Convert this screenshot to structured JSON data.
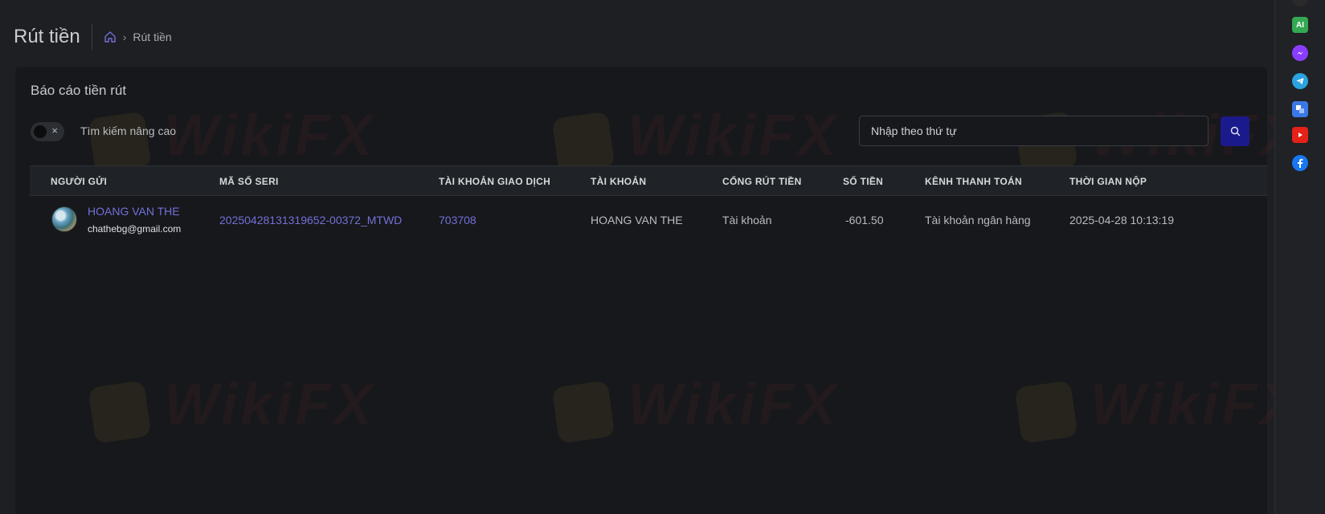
{
  "header": {
    "title": "Rút tiền",
    "breadcrumb_current": "Rút tiền"
  },
  "card": {
    "title": "Báo cáo tiền rút",
    "advanced_search_label": "Tìm kiếm nâng cao",
    "toggle_x": "×",
    "search_placeholder": "Nhập theo thứ tự"
  },
  "table": {
    "columns": [
      "NGƯỜI GỬI",
      "MÃ SỐ SERI",
      "TÀI KHOẢN GIAO DỊCH",
      "TÀI KHOẢN",
      "CỔNG RÚT TIỀN",
      "SỐ TIỀN",
      "KÊNH THANH TOÁN",
      "THỜI GIAN NỘP"
    ],
    "rows": [
      {
        "sender_name": "HOANG VAN THE",
        "sender_email": "chathebg@gmail.com",
        "serial": "20250428131319652-00372_MTWD",
        "trading_account": "703708",
        "account": "HOANG VAN THE",
        "gateway": "Tài khoản",
        "amount": "-601.50",
        "channel": "Tài khoản ngân hàng",
        "submitted": "2025-04-28 10:13:19"
      }
    ]
  },
  "sidebar": {
    "ai_label": "AI"
  },
  "watermark": "WikiFX",
  "colors": {
    "accent": "#7470d9",
    "search_button": "#1b1a8c",
    "background": "#1d1f23",
    "card": "#16181b"
  }
}
